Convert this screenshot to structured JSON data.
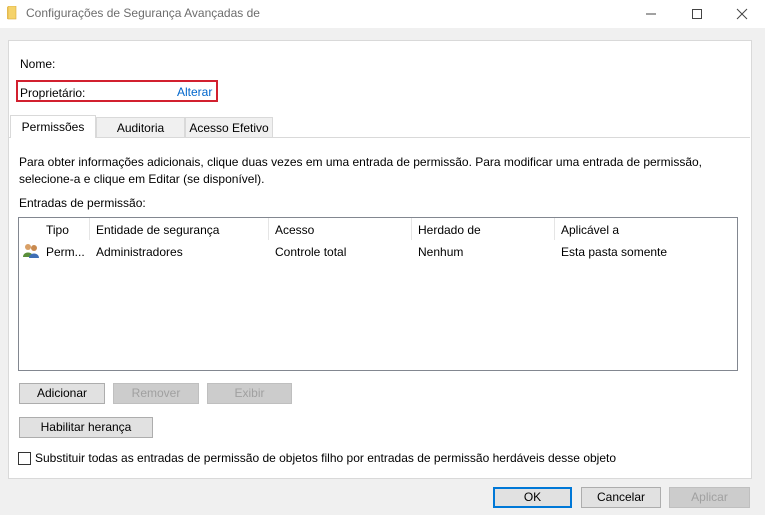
{
  "window": {
    "title": "Configurações de Segurança Avançadas de"
  },
  "info": {
    "name_label": "Nome:",
    "owner_label": "Proprietário:",
    "owner_change_link": "Alterar"
  },
  "tabs": [
    {
      "label": "Permissões",
      "active": true
    },
    {
      "label": "Auditoria",
      "active": false
    },
    {
      "label": "Acesso Efetivo",
      "active": false
    }
  ],
  "permissions": {
    "description": "Para obter informações adicionais, clique duas vezes em uma entrada de permissão. Para modificar uma entrada de permissão, selecione-a e clique em Editar (se disponível).",
    "entries_label": "Entradas de permissão:",
    "columns": [
      "Tipo",
      "Entidade de segurança",
      "Acesso",
      "Herdado de",
      "Aplicável a"
    ],
    "rows": [
      {
        "icon": "users-icon",
        "type": "Perm...",
        "principal": "Administradores",
        "access": "Controle total",
        "inherited_from": "Nenhum",
        "applies_to": "Esta pasta somente"
      }
    ]
  },
  "buttons": {
    "add": "Adicionar",
    "remove": "Remover",
    "view": "Exibir",
    "enable_inheritance": "Habilitar herança",
    "ok": "OK",
    "cancel": "Cancelar",
    "apply": "Aplicar"
  },
  "replace_child_checkbox": {
    "label": "Substituir todas as entradas de permissão de objetos filho por entradas de permissão herdáveis desse objeto",
    "checked": false
  },
  "colors": {
    "highlight_border": "#d2202f",
    "link": "#0066cc",
    "focus_border": "#0078d7"
  }
}
